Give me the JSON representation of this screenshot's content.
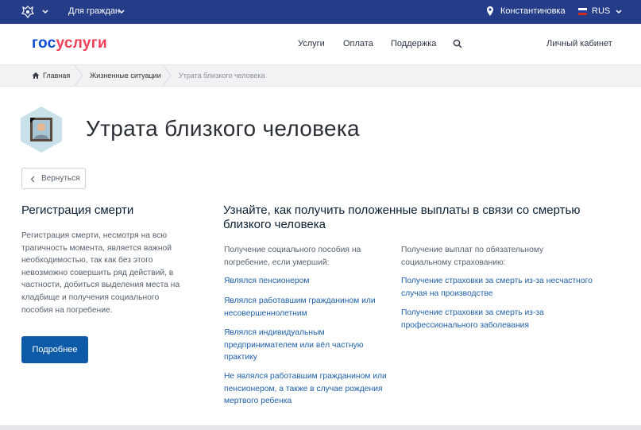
{
  "topbar": {
    "for_citizens": "Для граждан",
    "city": "Константиновка",
    "language": "RUS",
    "flag_colors": [
      "#ffffff",
      "#1c3fa8",
      "#d52b1e"
    ]
  },
  "header": {
    "logo_part1": "гос",
    "logo_part2": "услуги",
    "nav": [
      "Услуги",
      "Оплата",
      "Поддержка"
    ],
    "cabinet": "Личный кабинет"
  },
  "breadcrumb": [
    "Главная",
    "Жизненные ситуации",
    "Утрата близкого человека"
  ],
  "page": {
    "title": "Утрата близкого человека",
    "back_label": "Вернуться"
  },
  "left": {
    "title": "Регистрация смерти",
    "lines": [
      "Регистрация смерти, несмотря на всю",
      "трагичность момента, является важной",
      "необходимостью, так как без этого",
      "невозможно совершить ряд действий, в",
      "частности, добиться выделения места на",
      "кладбище и получения социального",
      "пособия на погребение."
    ],
    "button": "Подробнее"
  },
  "right": {
    "title_lines": [
      "Узнайте, как получить положенные выплаты в связи со смертью",
      "близкого человека"
    ],
    "col1": {
      "intro": [
        "Получение социального пособия на",
        "погребение, если умерший:"
      ],
      "links": [
        [
          "Являлся пенсионером"
        ],
        [
          "Являлся работавшим гражданином или",
          "несовершеннолетним"
        ],
        [
          "Являлся индивидуальным",
          "предпринимателем или вёл частную",
          "практику"
        ],
        [
          "Не являлся работавшим гражданином или",
          "пенсионером, а также в случае рождения",
          "мертвого ребенка"
        ]
      ]
    },
    "col2": {
      "intro": [
        "Получение выплат по обязательному",
        "социальному страхованию:"
      ],
      "links": [
        [
          "Получение страховки за смерть из-за несчастного",
          "случая на производстве"
        ],
        [
          "Получение страховки за смерть из-за",
          "профессионального заболевания"
        ]
      ]
    }
  },
  "colors": {
    "topbar": "#253d88",
    "logo_blue": "#0d4cd3",
    "logo_red": "#ee3f58",
    "link": "#1d5fa8",
    "button": "#0d5aa8"
  }
}
